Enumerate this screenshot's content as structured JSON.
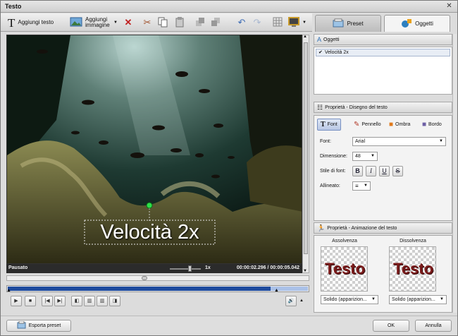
{
  "window": {
    "title": "Testo"
  },
  "toolbar": {
    "add_text_label": "Aggiungi testo",
    "add_image_label": "Aggiungi immagine"
  },
  "tabs": [
    {
      "label": "Preset"
    },
    {
      "label": "Oggetti"
    }
  ],
  "preview": {
    "overlay_text": "Velocità 2x"
  },
  "status": {
    "state": "Pausato",
    "speed": "1x",
    "time": "00:00:02.296 / 00:00:05.042"
  },
  "objects": {
    "header": "Oggetti",
    "items": [
      {
        "label": "Velocità 2x",
        "checked": true
      }
    ]
  },
  "drawing": {
    "header": "Proprietà - Disegno del testo",
    "tabs": [
      "Font",
      "Pennello",
      "Ombra",
      "Bordo"
    ],
    "font_label": "Font:",
    "font_value": "Arial",
    "size_label": "Dimensione:",
    "size_value": "48",
    "style_label": "Stile di font:",
    "style_buttons": [
      "B",
      "I",
      "U",
      "S"
    ],
    "align_label": "Allineato:"
  },
  "animation": {
    "header": "Proprietà - Animazione del testo",
    "fade_in_label": "Assolvenza",
    "fade_out_label": "Dissolvenza",
    "thumb_text": "Testo",
    "fade_in_value": "Solido (apparizion...",
    "fade_out_value": "Solido (apparizion..."
  },
  "bottom": {
    "export_label": "Esporta preset",
    "ok_label": "OK",
    "cancel_label": "Annulla"
  },
  "timeline": {
    "position_fraction": 0.455,
    "played_fraction": 0.875
  }
}
